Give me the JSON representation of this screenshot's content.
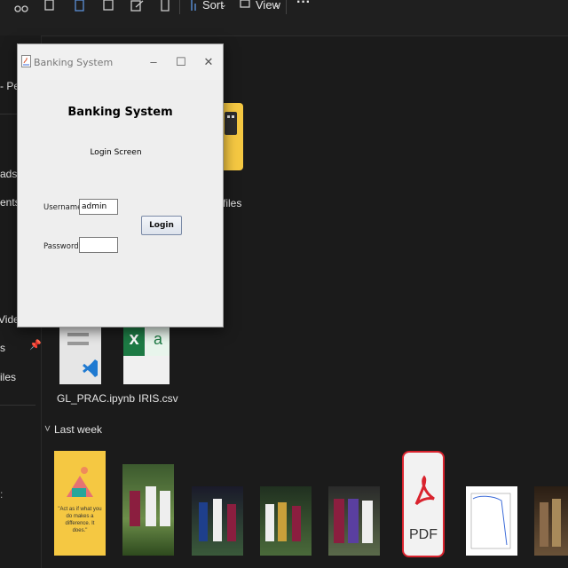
{
  "explorer": {
    "toolbar": {
      "sort_label": "Sort",
      "view_label": "View",
      "more_label": "···"
    },
    "sidebar": {
      "items": [
        "- Pers",
        "ads",
        "ents",
        "Videos",
        "s",
        "iles"
      ]
    },
    "content": {
      "folder_partial_label": "files",
      "files": [
        {
          "name": "GL_PRAC.ipynb",
          "icon": "vscode-notebook-icon"
        },
        {
          "name": "IRIS.csv",
          "icon": "excel-csv-icon"
        }
      ],
      "section_header": "Last week",
      "poster_text": "\"Act as if what you do makes a difference. It does.\"",
      "pdf_label": "PDF"
    }
  },
  "dialog": {
    "window_title": "Banking System",
    "heading": "Banking System",
    "subtitle": "Login Screen",
    "username_label": "Username:",
    "username_value": "admin",
    "password_label": "Password:",
    "password_value": "",
    "login_button": "Login",
    "controls": {
      "minimize": "–",
      "maximize": "☐",
      "close": "✕"
    }
  },
  "colors": {
    "explorer_bg": "#1b1b1b",
    "dialog_bg": "#eeeeee",
    "folder_yellow": "#f5c842",
    "pdf_red": "#d9232e",
    "excel_green": "#1d7a44"
  }
}
